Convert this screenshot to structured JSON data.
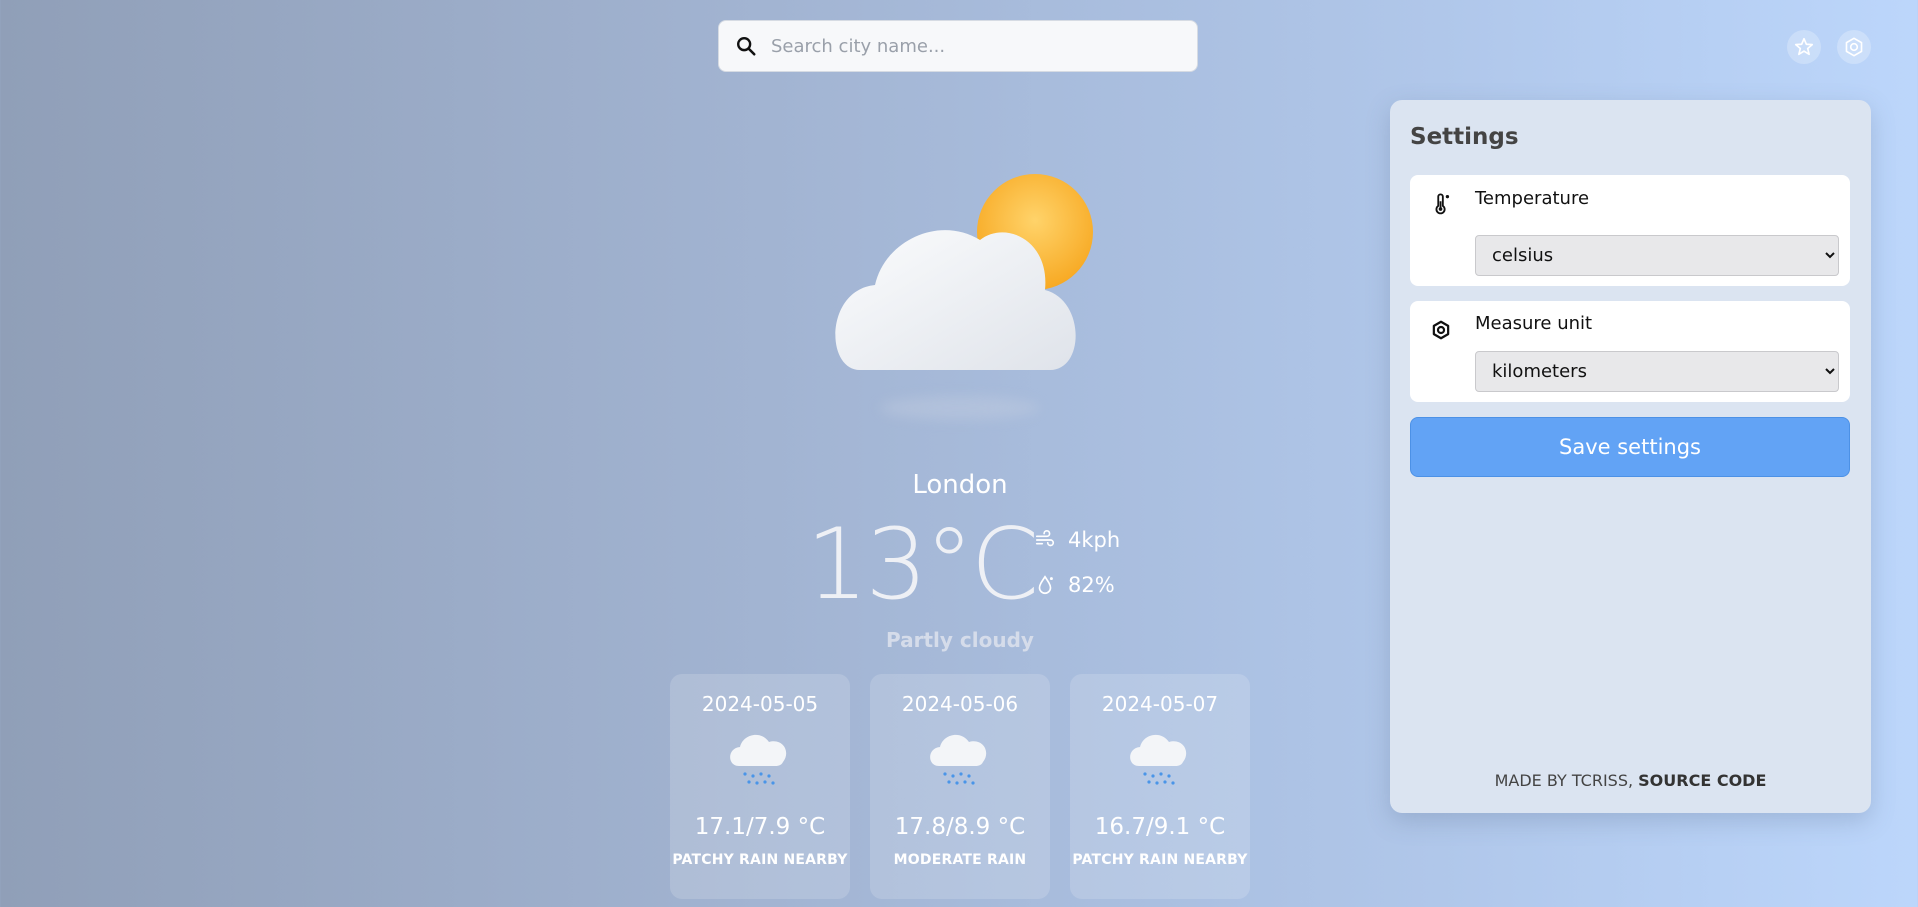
{
  "search": {
    "placeholder": "Search city name..."
  },
  "topbar": {
    "icons": [
      "star-icon",
      "gear-icon"
    ]
  },
  "weather": {
    "city": "London",
    "temperature": "13°C",
    "wind": "4kph",
    "humidity": "82%",
    "condition": "Partly cloudy"
  },
  "forecast": [
    {
      "date": "2024-05-05",
      "range": "17.1/7.9 °C",
      "desc": "PATCHY RAIN NEARBY"
    },
    {
      "date": "2024-05-06",
      "range": "17.8/8.9 °C",
      "desc": "MODERATE RAIN"
    },
    {
      "date": "2024-05-07",
      "range": "16.7/9.1 °C",
      "desc": "PATCHY RAIN NEARBY"
    }
  ],
  "settings": {
    "title": "Settings",
    "temperature_label": "Temperature",
    "temperature_value": "celsius",
    "measure_label": "Measure unit",
    "measure_value": "kilometers",
    "save_label": "Save settings",
    "credit_prefix": "MADE BY TCRISS,",
    "credit_link": "SOURCE CODE"
  },
  "colors": {
    "accent": "#62a3f5",
    "panel": "#dbe4f1"
  }
}
